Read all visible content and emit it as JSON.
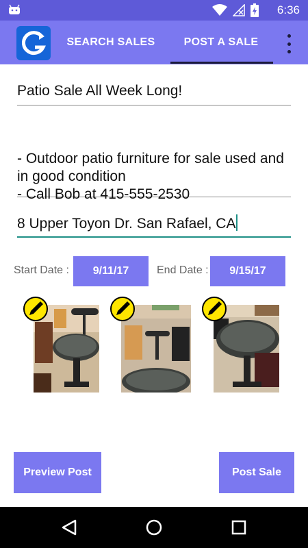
{
  "status_bar": {
    "time": "6:36",
    "icons": [
      "android-icon",
      "wifi-icon",
      "no-signal-icon",
      "battery-charging-icon"
    ]
  },
  "app_bar": {
    "tabs": [
      {
        "label": "SEARCH SALES",
        "selected": false
      },
      {
        "label": "POST A SALE",
        "selected": true
      }
    ],
    "icons": [
      "app-logo-icon",
      "overflow-menu-icon"
    ]
  },
  "form": {
    "title": "Patio Sale All Week Long!",
    "description": "- Outdoor patio furniture for sale used and in good condition\n- Call Bob at 415-555-2530",
    "address": "8 Upper Toyon Dr. San Rafael, CA",
    "start_date_label": "Start Date :",
    "start_date": "9/11/17",
    "end_date_label": "End Date :",
    "end_date": "9/15/17"
  },
  "photos": [
    {
      "name": "photo-1",
      "icon": "pencil-edit-icon"
    },
    {
      "name": "photo-2",
      "icon": "pencil-edit-icon"
    },
    {
      "name": "photo-3",
      "icon": "pencil-edit-icon"
    }
  ],
  "actions": {
    "preview_label": "Preview Post",
    "post_label": "Post Sale"
  },
  "nav_bar": {
    "icons": [
      "back-icon",
      "home-icon",
      "recents-icon"
    ]
  },
  "colors": {
    "primary": "#7b78f0",
    "status_bar": "#5e5ad8",
    "accent": "#1e8f86",
    "edit_badge": "#ffe600"
  }
}
